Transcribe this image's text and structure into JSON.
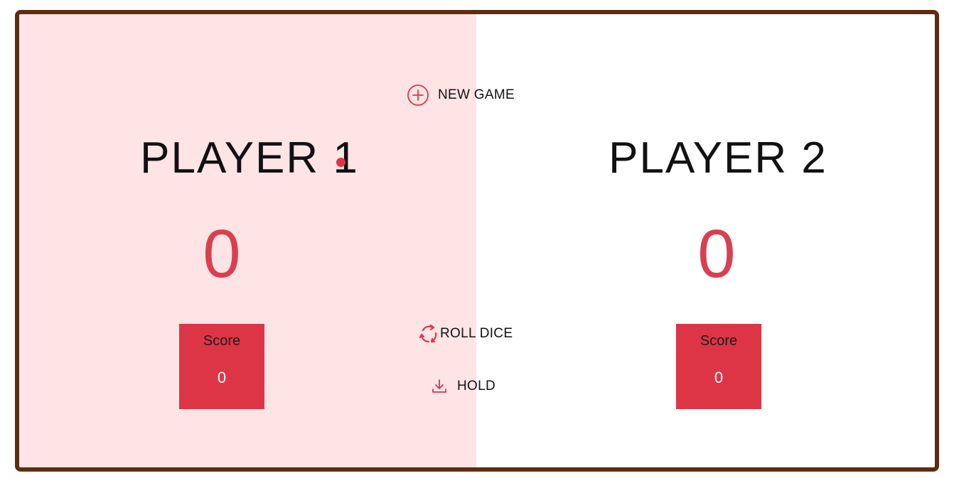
{
  "buttons": {
    "new_game": "NEW GAME",
    "roll_dice": "ROLL DICE",
    "hold": "HOLD"
  },
  "players": [
    {
      "name": "PLAYER 1",
      "total_score": "0",
      "current_label": "Score",
      "current_score": "0",
      "active": true
    },
    {
      "name": "PLAYER 2",
      "total_score": "0",
      "current_label": "Score",
      "current_score": "0",
      "active": false
    }
  ],
  "icons": {
    "new_game": "plus-circle-icon",
    "roll_dice": "refresh-icon",
    "hold": "download-icon",
    "active_player": "active-dot-icon"
  },
  "colors": {
    "accent": "#de3546",
    "active_panel": "#ffe4e6",
    "border": "#5e2c10",
    "score": "#d9404f"
  }
}
